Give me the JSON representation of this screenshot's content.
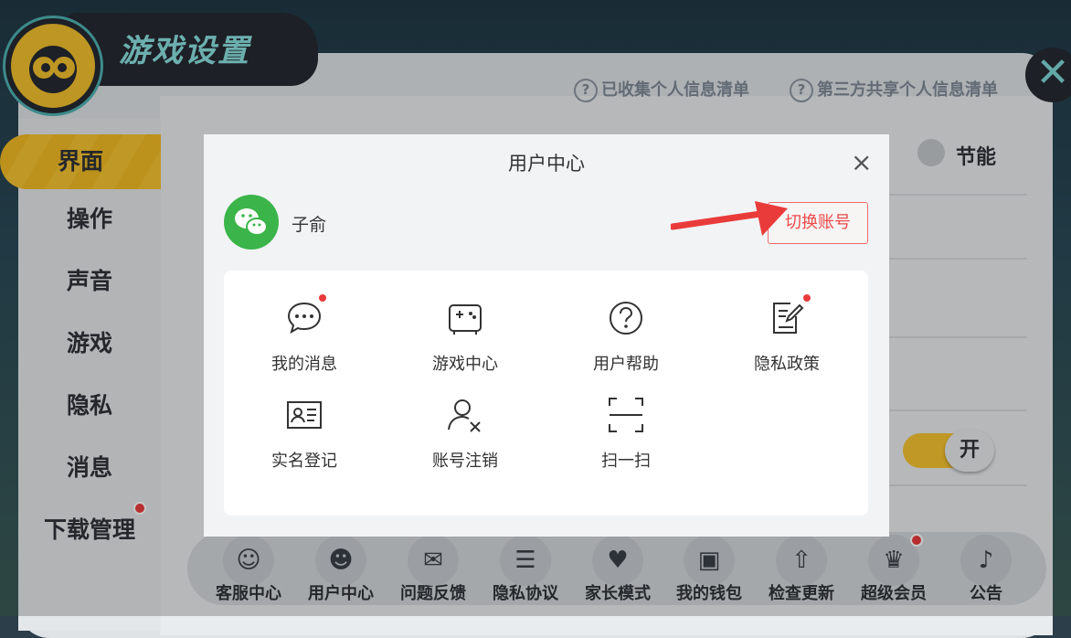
{
  "settings": {
    "title": "游戏设置",
    "sidebar": [
      "界面",
      "操作",
      "声音",
      "游戏",
      "隐私",
      "消息",
      "下载管理"
    ],
    "links": [
      "已收集个人信息清单",
      "第三方共享个人信息清单"
    ],
    "energy_label": "节能",
    "toggle_label": "开",
    "bottom_items": [
      "客服中心",
      "用户中心",
      "问题反馈",
      "隐私协议",
      "家长模式",
      "我的钱包",
      "检查更新",
      "超级会员",
      "公告"
    ],
    "close_glyph": "✕"
  },
  "dialog": {
    "title": "用户中心",
    "close_glyph": "×",
    "user_name": "子俞",
    "switch_button": "切换账号",
    "items": [
      "我的消息",
      "游戏中心",
      "用户帮助",
      "隐私政策",
      "实名登记",
      "账号注销",
      "扫一扫"
    ]
  },
  "colors": {
    "accent": "#f5c331",
    "wechat": "#3bb54a",
    "alert": "#ea3b3b"
  }
}
